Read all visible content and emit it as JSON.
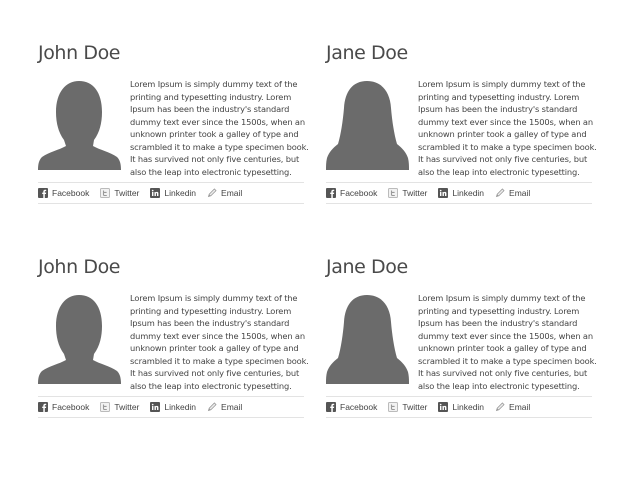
{
  "cards": [
    {
      "name": "John Doe",
      "gender": "male",
      "bio": "Lorem Ipsum is simply dummy text of the printing and typesetting industry. Lorem Ipsum has been the industry's standard dummy text ever since the 1500s, when an unknown printer took a galley of type and scrambled it to make a type specimen book. It has survived not only five centuries, but also the leap into electronic typesetting.",
      "links": {
        "facebook": "Facebook",
        "twitter": "Twitter",
        "linkedin": "Linkedin",
        "email": "Email"
      }
    },
    {
      "name": "Jane Doe",
      "gender": "female",
      "bio": "Lorem Ipsum is simply dummy text of the printing and typesetting industry. Lorem Ipsum has been the industry's standard dummy text ever since the 1500s, when an unknown printer took a galley of type and scrambled it to make a type specimen book. It has survived not only five centuries, but also the leap into electronic typesetting.",
      "links": {
        "facebook": "Facebook",
        "twitter": "Twitter",
        "linkedin": "Linkedin",
        "email": "Email"
      }
    },
    {
      "name": "John Doe",
      "gender": "male",
      "bio": "Lorem Ipsum is simply dummy text of the printing and typesetting industry. Lorem Ipsum has been the industry's standard dummy text ever since the 1500s, when an unknown printer took a galley of type and scrambled it to make a type specimen book. It has survived not only five centuries, but also the leap into electronic typesetting.",
      "links": {
        "facebook": "Facebook",
        "twitter": "Twitter",
        "linkedin": "Linkedin",
        "email": "Email"
      }
    },
    {
      "name": "Jane Doe",
      "gender": "female",
      "bio": "Lorem Ipsum is simply dummy text of the printing and typesetting industry. Lorem Ipsum has been the industry's standard dummy text ever since the 1500s, when an unknown printer took a galley of type and scrambled it to make a type specimen book. It has survived not only five centuries, but also the leap into electronic typesetting.",
      "links": {
        "facebook": "Facebook",
        "twitter": "Twitter",
        "linkedin": "Linkedin",
        "email": "Email"
      }
    }
  ],
  "icons": [
    "facebook-icon",
    "twitter-icon",
    "linkedin-icon",
    "email-icon"
  ],
  "colors": {
    "avatar": "#6b6b6b",
    "text": "#444444",
    "divider": "#e3e3e3"
  }
}
